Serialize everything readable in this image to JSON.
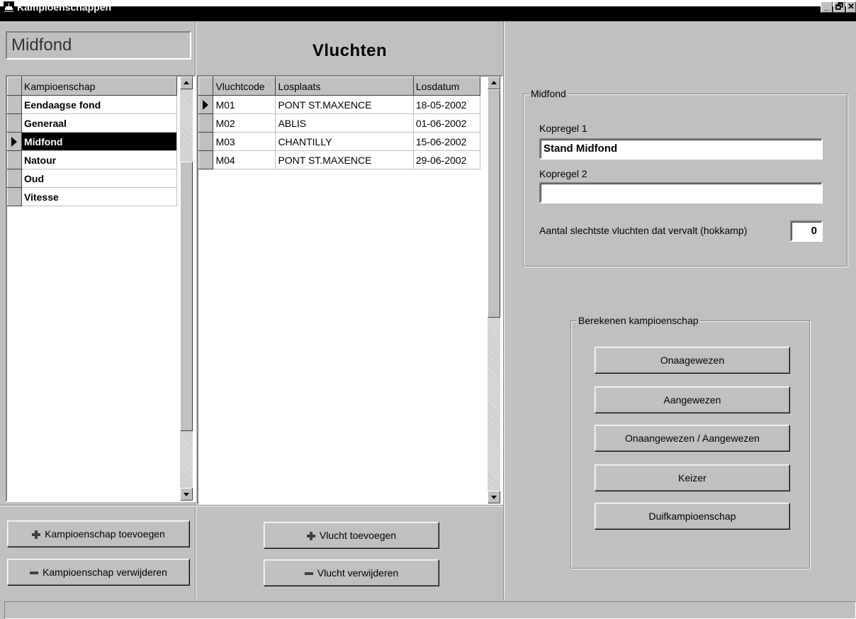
{
  "window": {
    "title": "Kampioenschappen",
    "minimize_label": "_",
    "maximize_label": "🗗",
    "close_label": "✕"
  },
  "left": {
    "current_name": "Midfond",
    "grid_header": "Kampioenschap",
    "items": [
      "Eendaagse fond",
      "Generaal",
      "Midfond",
      "Natour",
      "Oud",
      "Vitesse"
    ],
    "selected_index": 2,
    "add_button": "Kampioenschap toevoegen",
    "remove_button": "Kampioenschap verwijderen"
  },
  "middle": {
    "title": "Vluchten",
    "columns": [
      "Vluchtcode",
      "Losplaats",
      "Losdatum"
    ],
    "rows": [
      {
        "code": "M01",
        "place": "PONT ST.MAXENCE",
        "date": "18-05-2002"
      },
      {
        "code": "M02",
        "place": "ABLIS",
        "date": "01-06-2002"
      },
      {
        "code": "M03",
        "place": "CHANTILLY",
        "date": "15-06-2002"
      },
      {
        "code": "M04",
        "place": "PONT ST.MAXENCE",
        "date": "29-06-2002"
      }
    ],
    "current_row": 0,
    "add_button": "Vlucht toevoegen",
    "remove_button": "Vlucht verwijderen"
  },
  "right": {
    "group_title": "Midfond",
    "kopregel1_label": "Kopregel 1",
    "kopregel1_value": "Stand Midfond",
    "kopregel2_label": "Kopregel 2",
    "kopregel2_value": "",
    "aantal_label": "Aantal slechtste vluchten dat vervalt (hokkamp)",
    "aantal_value": "0",
    "calc_group_title": "Berekenen kampioenschap",
    "calc_buttons": [
      "Onaagewezen",
      "Aangewezen",
      "Onaangewezen / Aangewezen",
      "Keizer",
      "Duifkampioenschap"
    ]
  },
  "status": {
    "text": ""
  }
}
